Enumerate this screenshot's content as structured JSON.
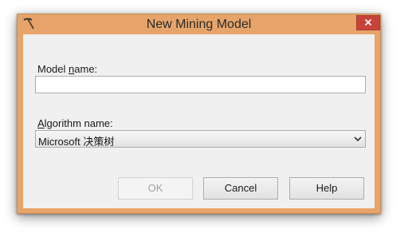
{
  "window": {
    "title": "New Mining Model",
    "app_icon": "pickaxe-icon",
    "close_icon": "close-icon"
  },
  "form": {
    "model_name_label_pre": "Model ",
    "model_name_label_mn": "n",
    "model_name_label_post": "ame:",
    "model_name_value": "",
    "algorithm_label_mn": "A",
    "algorithm_label_post": "lgorithm name:",
    "algorithm_value": "Microsoft 决策树",
    "algorithm_dropdown_icon": "chevron-down-icon"
  },
  "buttons": {
    "ok": "OK",
    "cancel": "Cancel",
    "help": "Help"
  },
  "colors": {
    "titlebar": "#e7a46a",
    "close": "#c7433a",
    "client": "#f0f0f0"
  }
}
